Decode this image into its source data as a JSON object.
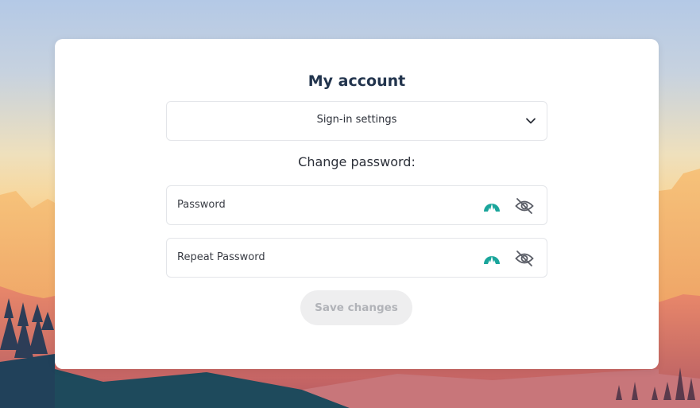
{
  "account": {
    "title": "My account",
    "settings_select": {
      "label": "Sign-in settings"
    },
    "change_password_label": "Change password:",
    "fields": {
      "password": {
        "placeholder": "Password"
      },
      "repeat_password": {
        "placeholder": "Repeat Password"
      }
    },
    "save_label": "Save changes"
  },
  "icons": {
    "select_caret": "chevron-down-icon",
    "field_extension": "nordpass-icon",
    "visibility_toggle": "eye-off-icon"
  },
  "colors": {
    "title": "#22344d",
    "extension_icon": "#1aa59b",
    "button_bg": "#eeeeef",
    "button_text": "#b1b3b8",
    "field_border": "#e3e5e9"
  }
}
